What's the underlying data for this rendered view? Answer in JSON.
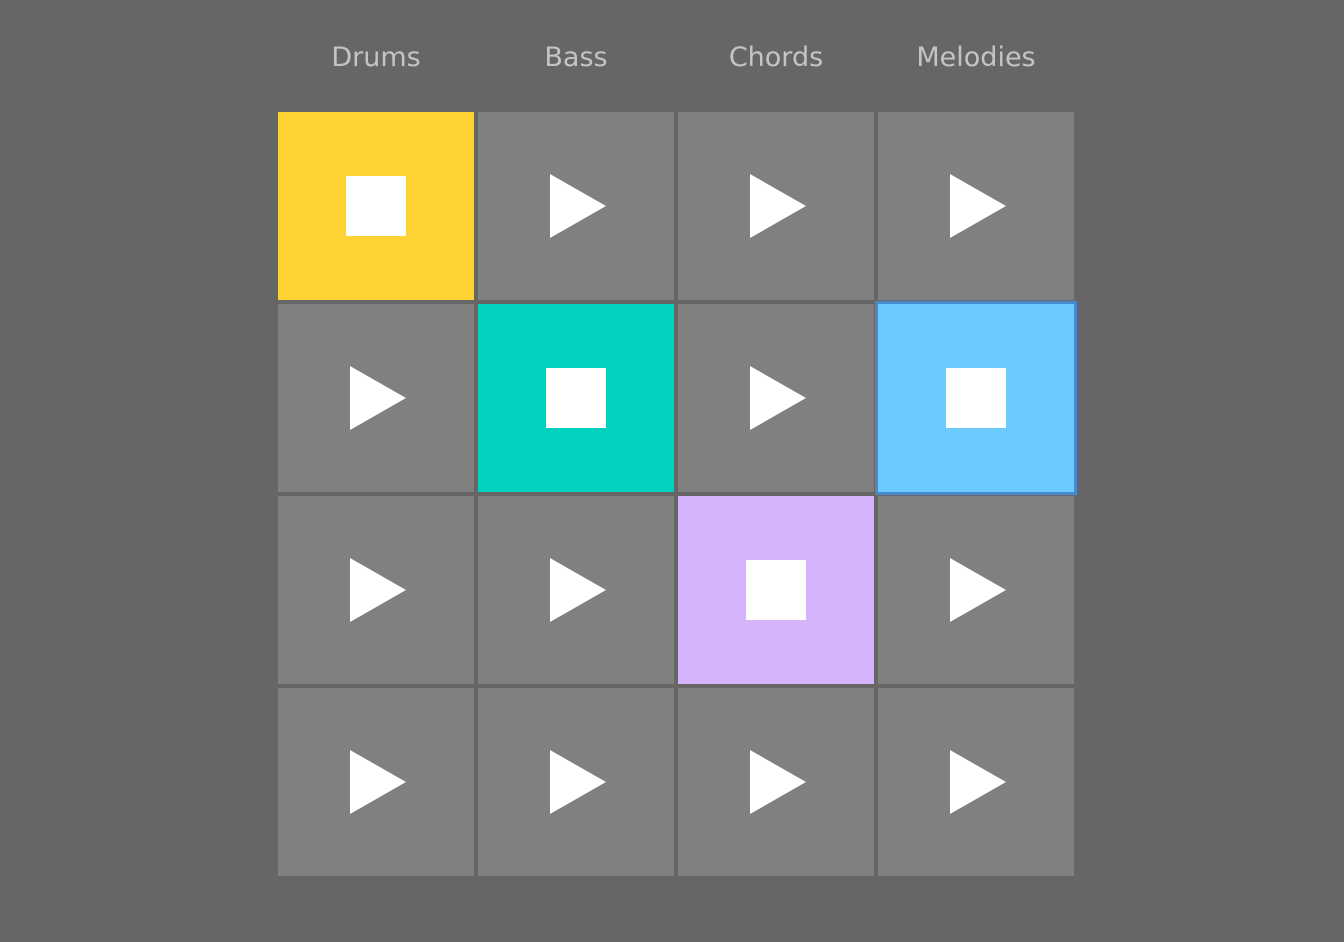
{
  "columns": [
    "Drums",
    "Bass",
    "Chords",
    "Melodies"
  ],
  "colors": {
    "idle": "#808080",
    "Drums": "#ffd234",
    "Bass": "#00d2be",
    "Chords": "#d5b4fc",
    "Melodies": "#6ccaff",
    "focus_ring": "#4a88cc"
  },
  "rows": [
    [
      "playing",
      "stopped",
      "stopped",
      "stopped"
    ],
    [
      "stopped",
      "playing",
      "stopped",
      "playing"
    ],
    [
      "stopped",
      "stopped",
      "playing",
      "stopped"
    ],
    [
      "stopped",
      "stopped",
      "stopped",
      "stopped"
    ]
  ],
  "focused_cell": {
    "row": 2,
    "column": "Melodies"
  },
  "icons": {
    "playing": "stop-icon",
    "stopped": "play-icon"
  }
}
